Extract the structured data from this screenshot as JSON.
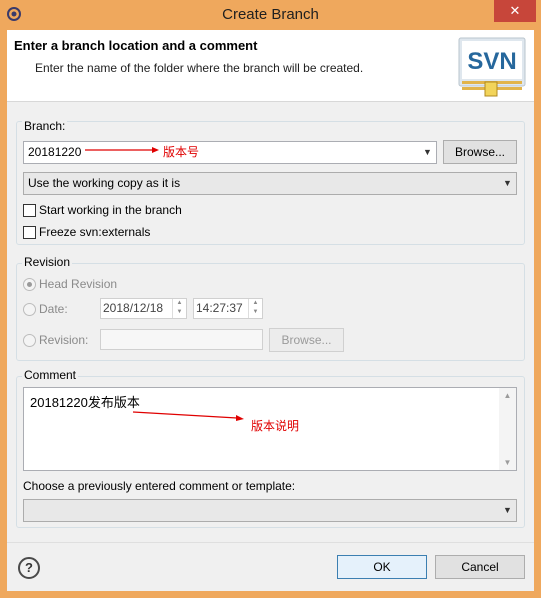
{
  "window": {
    "title": "Create Branch",
    "close_label": "✕"
  },
  "header": {
    "title": "Enter a branch location and a comment",
    "subtitle": "Enter the name of the folder where the branch will be created.",
    "logo_text": "SVN"
  },
  "branch": {
    "group_label": "Branch:",
    "url_value": "20181220",
    "browse_label": "Browse...",
    "copy_mode_value": "Use the working copy as it is",
    "start_working_label": "Start working in the branch",
    "start_working_checked": false,
    "freeze_externals_label": "Freeze svn:externals",
    "freeze_externals_checked": false
  },
  "revision": {
    "group_label": "Revision",
    "head_label": "Head Revision",
    "head_selected": true,
    "date_label": "Date:",
    "date_value": "2018/12/18",
    "time_value": "14:27:37",
    "revision_label": "Revision:",
    "revision_value": "",
    "browse_label": "Browse..."
  },
  "comment": {
    "group_label": "Comment",
    "text": "20181220发布版本",
    "template_label": "Choose a previously entered comment or template:",
    "template_value": ""
  },
  "annotations": {
    "branch_note": "版本号",
    "comment_note": "版本说明",
    "color": "#e00000"
  },
  "footer": {
    "help_label": "?",
    "ok_label": "OK",
    "cancel_label": "Cancel"
  },
  "colors": {
    "title_bar": "#efa85d",
    "close_button": "#c7463a",
    "dialog_bg": "#f0f0f0",
    "header_bg": "#ffffff"
  }
}
